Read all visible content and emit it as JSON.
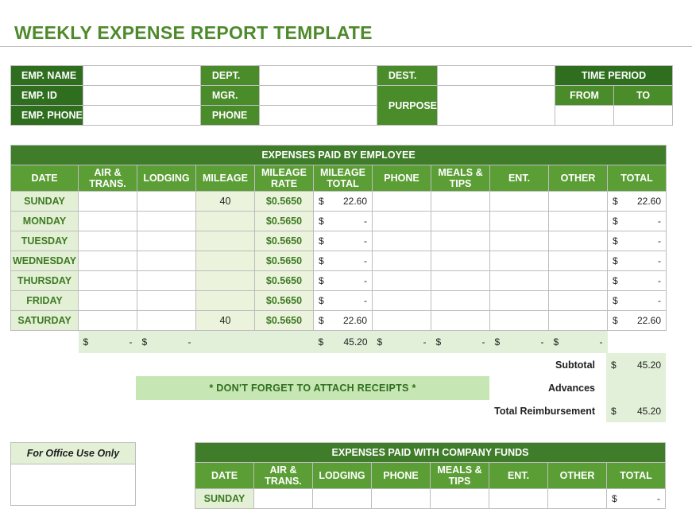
{
  "title": "WEEKLY EXPENSE REPORT TEMPLATE",
  "info": {
    "emp_name": "EMP. NAME",
    "emp_id": "EMP. ID",
    "emp_phone": "EMP. PHONE",
    "dept": "DEPT.",
    "mgr": "MGR.",
    "phone": "PHONE",
    "dest": "DEST.",
    "purpose": "PURPOSE",
    "time_period": "TIME PERIOD",
    "from": "FROM",
    "to": "TO"
  },
  "expenses": {
    "banner": "EXPENSES PAID BY EMPLOYEE",
    "columns": [
      "DATE",
      "AIR &\nTRANS.",
      "LODGING",
      "MILEAGE",
      "MILEAGE\nRATE",
      "MILEAGE\nTOTAL",
      "PHONE",
      "MEALS &\nTIPS",
      "ENT.",
      "OTHER",
      "TOTAL"
    ],
    "rows": [
      {
        "day": "SUNDAY",
        "mileage": "40",
        "rate": "$0.5650",
        "mileage_total": "22.60",
        "total": "22.60"
      },
      {
        "day": "MONDAY",
        "mileage": "",
        "rate": "$0.5650",
        "mileage_total": "-",
        "total": "-"
      },
      {
        "day": "TUESDAY",
        "mileage": "",
        "rate": "$0.5650",
        "mileage_total": "-",
        "total": "-"
      },
      {
        "day": "WEDNESDAY",
        "mileage": "",
        "rate": "$0.5650",
        "mileage_total": "-",
        "total": "-"
      },
      {
        "day": "THURSDAY",
        "mileage": "",
        "rate": "$0.5650",
        "mileage_total": "-",
        "total": "-"
      },
      {
        "day": "FRIDAY",
        "mileage": "",
        "rate": "$0.5650",
        "mileage_total": "-",
        "total": "-"
      },
      {
        "day": "SATURDAY",
        "mileage": "40",
        "rate": "$0.5650",
        "mileage_total": "22.60",
        "total": "22.60"
      }
    ],
    "currency": "$",
    "sums": {
      "air": "-",
      "lodging": "-",
      "mileage_total": "45.20",
      "phone": "-",
      "meals": "-",
      "ent": "-",
      "other": "-"
    }
  },
  "summary": {
    "subtotal_label": "Subtotal",
    "subtotal_value": "45.20",
    "advances_label": "Advances",
    "total_label": "Total Reimbursement",
    "total_value": "45.20"
  },
  "receipts_note": "* DON'T FORGET TO ATTACH RECEIPTS *",
  "office_use": "For Office Use Only",
  "company": {
    "banner": "EXPENSES PAID WITH COMPANY FUNDS",
    "columns": [
      "DATE",
      "AIR &\nTRANS.",
      "LODGING",
      "PHONE",
      "MEALS &\nTIPS",
      "ENT.",
      "OTHER",
      "TOTAL"
    ],
    "first_day": "SUNDAY",
    "first_total": "-"
  }
}
